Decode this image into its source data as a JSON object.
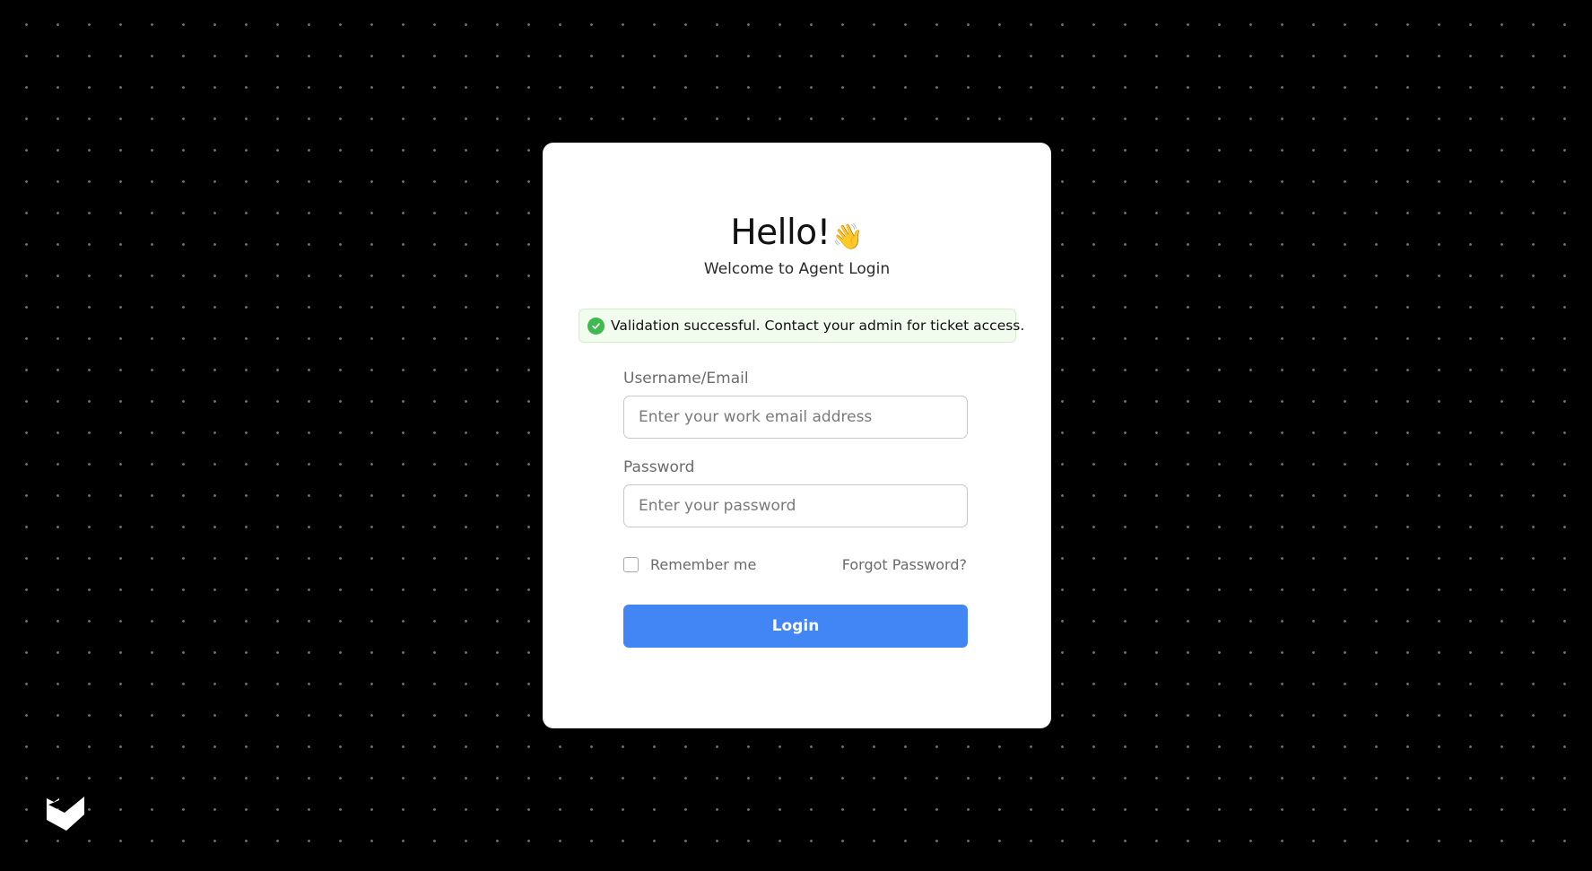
{
  "login_card": {
    "heading": "Hello!",
    "heading_emoji": "👋",
    "subtitle": "Welcome to Agent Login",
    "alert": {
      "icon": "check-circle-icon",
      "message": "Validation successful. Contact your admin for ticket access.",
      "color": "#3fb950"
    },
    "username": {
      "label": "Username/Email",
      "placeholder": "Enter your work email address",
      "value": ""
    },
    "password": {
      "label": "Password",
      "placeholder": "Enter your password",
      "value": ""
    },
    "remember_me": {
      "label": "Remember me",
      "checked": false
    },
    "forgot_password": "Forgot Password?",
    "login_button": "Login"
  },
  "colors": {
    "background": "#000000",
    "accent": "#4285f4",
    "success": "#3fb950"
  },
  "brand": {
    "logo_icon": "brand-logo-icon"
  }
}
